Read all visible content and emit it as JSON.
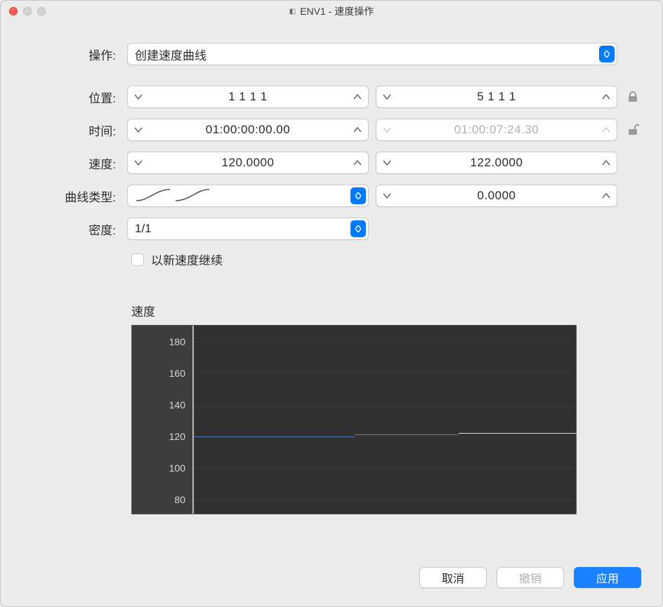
{
  "window": {
    "title": "ENV1 - 速度操作"
  },
  "labels": {
    "operation": "操作:",
    "position": "位置:",
    "time": "时间:",
    "speed": "速度:",
    "curve_type": "曲线类型:",
    "density": "密度:",
    "continue_new_speed": "以新速度继续",
    "speed_section": "速度"
  },
  "fields": {
    "operation_value": "创建速度曲线",
    "position_left": "1 1 1   1",
    "position_right": "5 1 1   1",
    "time_left": "01:00:00:00.00",
    "time_right": "01:00:07:24.30",
    "speed_left": "120.0000",
    "speed_right": "122.0000",
    "curve_param": "0.0000",
    "density_value": "1/1"
  },
  "buttons": {
    "cancel": "取消",
    "undo": "撤销",
    "apply": "应用"
  },
  "chart_data": {
    "type": "line",
    "ylabel": "Tempo",
    "ylim": [
      70,
      190
    ],
    "yticks": [
      80,
      100,
      120,
      140,
      160,
      180
    ],
    "series": [
      {
        "name": "tempo",
        "x": [
          0,
          0.5,
          1.0
        ],
        "values": [
          120,
          121,
          122
        ]
      }
    ]
  }
}
